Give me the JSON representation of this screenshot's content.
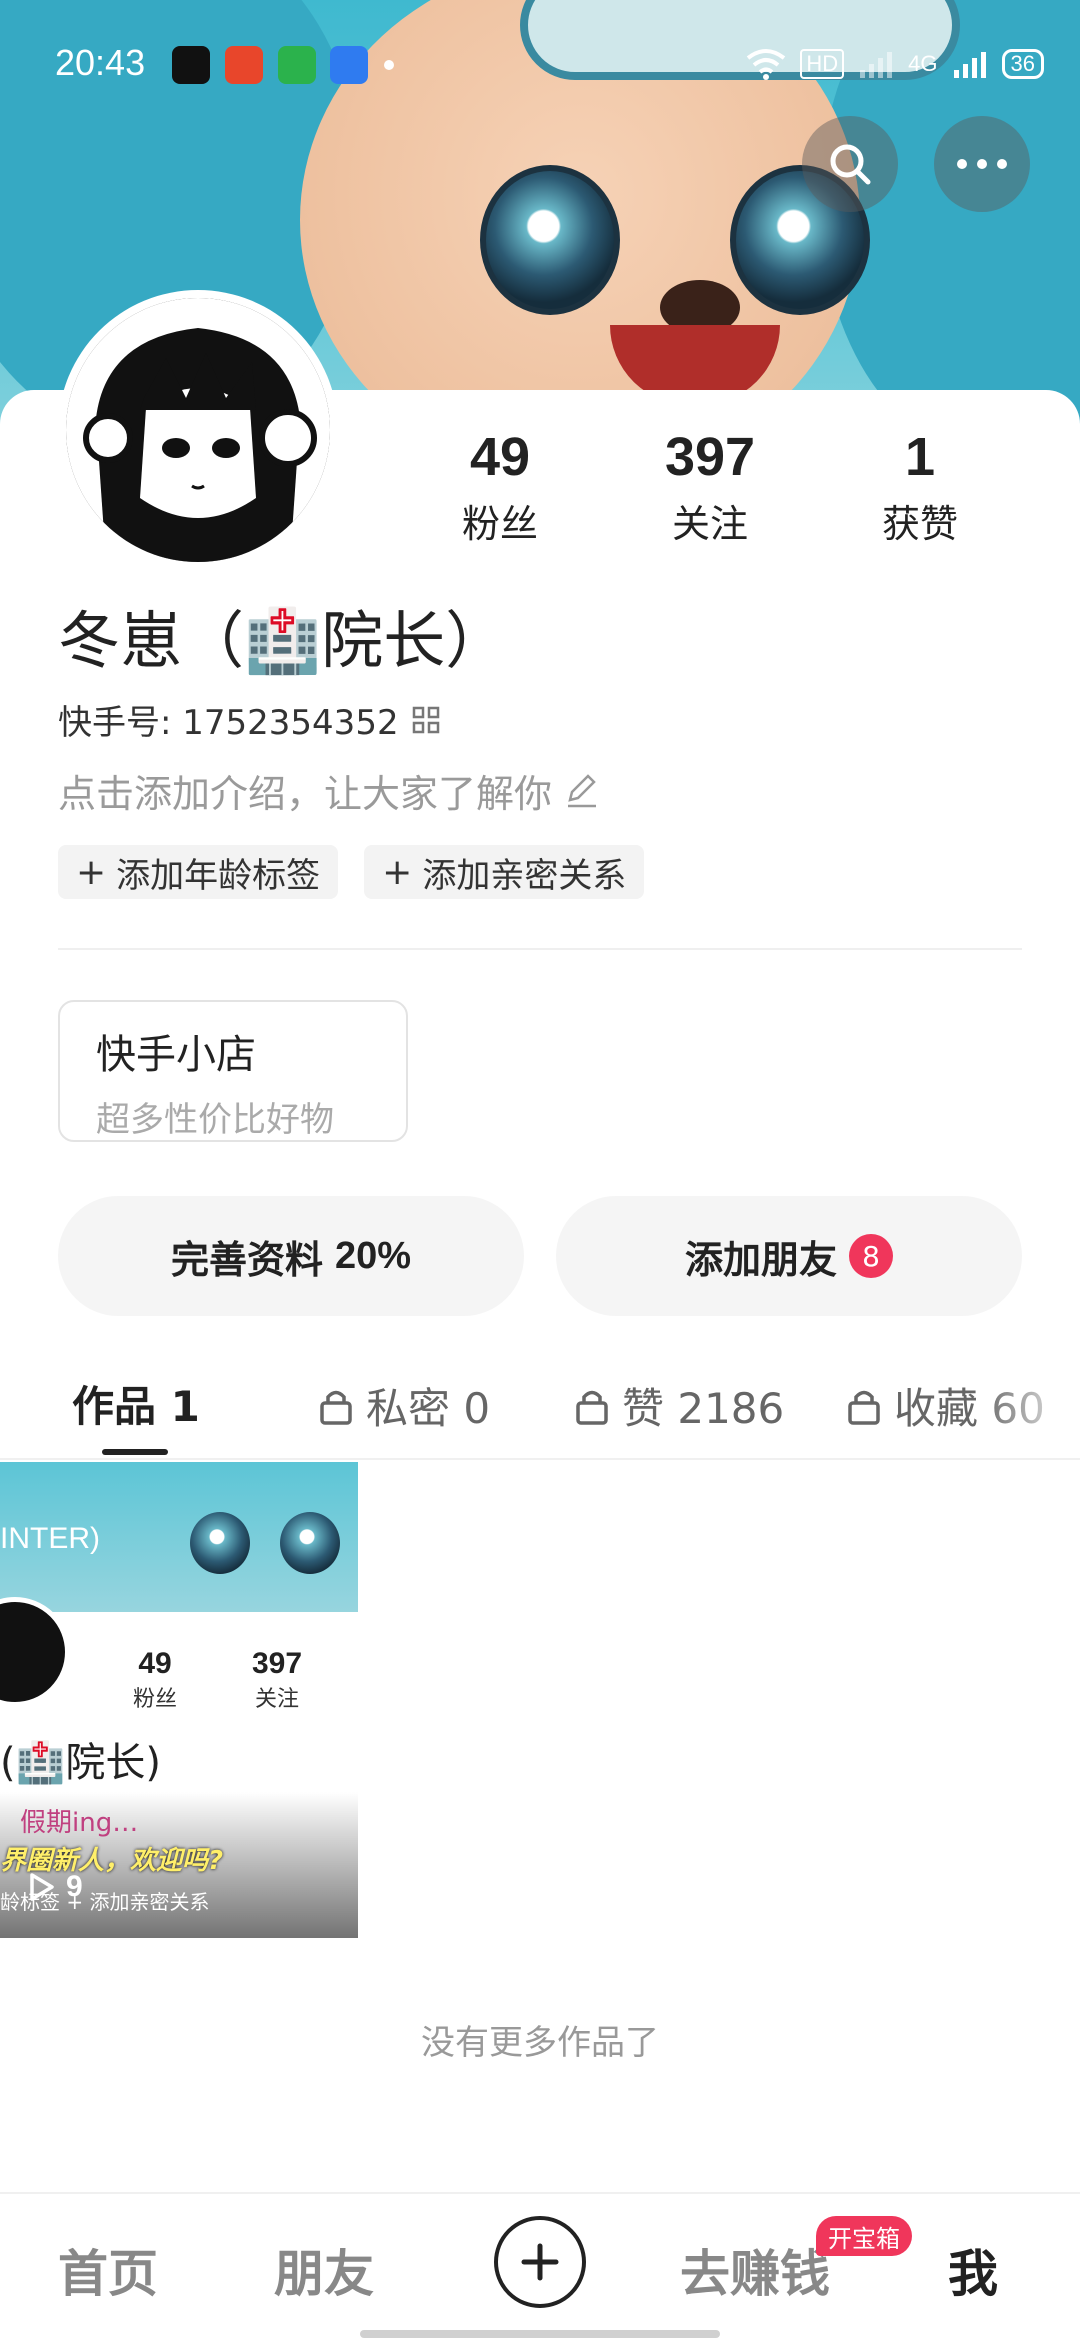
{
  "status_bar": {
    "time": "20:43",
    "network": "HD",
    "signal": "4G",
    "battery": "36"
  },
  "stats": [
    {
      "value": "49",
      "label": "粉丝"
    },
    {
      "value": "397",
      "label": "关注"
    },
    {
      "value": "1",
      "label": "获赞"
    }
  ],
  "profile": {
    "name": "冬崽（🏥院长）",
    "kuaishou_id": "快手号: 1752354352",
    "bio_placeholder": "点击添加介绍，让大家了解你",
    "tags": [
      "添加年龄标签",
      "添加亲密关系"
    ]
  },
  "shop": {
    "title": "快手小店",
    "subtitle": "超多性价比好物"
  },
  "actions": {
    "complete_profile": "完善资料",
    "complete_percent": "20%",
    "add_friends": "添加朋友",
    "friend_badge": "8"
  },
  "tabs": [
    {
      "label": "作品 1",
      "locked": false
    },
    {
      "label": "私密 0",
      "locked": true
    },
    {
      "label": "赞 2186",
      "locked": true
    },
    {
      "label": "收藏 60",
      "locked": true
    }
  ],
  "thumbnail": {
    "stat1_value": "49",
    "stat1_label": "粉丝",
    "stat2_value": "397",
    "stat2_label": "关注",
    "name": "(🏥院长)",
    "overlay_line1": "假期ing…",
    "overlay_line2": "界圈新人，欢迎吗?",
    "overlay_line3": "龄标签  + 添加亲密关系",
    "plays": "9",
    "cover_text": "INTER)"
  },
  "footer_text": "没有更多作品了",
  "bottom_nav": {
    "home": "首页",
    "friends": "朋友",
    "earn": "去赚钱",
    "earn_badge": "开宝箱",
    "me": "我"
  },
  "colors": {
    "accent_red": "#f0365b",
    "cover_blue": "#3fb9cf"
  }
}
